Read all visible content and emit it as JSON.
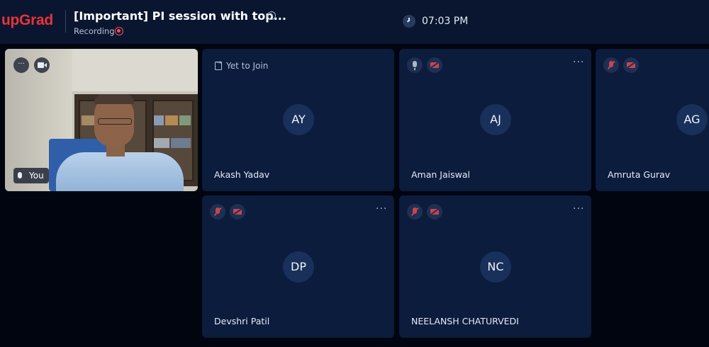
{
  "brand": {
    "logo": "upGrad",
    "accent": "#e8333a"
  },
  "header": {
    "title": "[Important] PI session with top...",
    "info_icon": "i",
    "status": "Recording",
    "time": "07:03 PM"
  },
  "self_tile": {
    "label": "You",
    "more": "···"
  },
  "participants": [
    {
      "initials": "AY",
      "name": "Akash Yadav",
      "status": "Yet to Join"
    },
    {
      "initials": "AJ",
      "name": "Aman Jaiswal",
      "more": "···"
    },
    {
      "initials": "AG",
      "name": "Amruta Gurav"
    },
    {
      "initials": "DP",
      "name": "Devshri Patil",
      "more": "···"
    },
    {
      "initials": "NC",
      "name": "NEELANSH CHATURVEDI",
      "more": "···"
    }
  ],
  "colors": {
    "tile_bg": "#0b1c3d",
    "page_bg": "#01050f",
    "topbar_bg": "#0a162f",
    "muted_red": "#c74552"
  },
  "icons": [
    "info-icon",
    "recording-icon",
    "clock-icon",
    "more-icon",
    "camera-icon",
    "speaker-icon",
    "join-icon",
    "mic-icon",
    "mic-off-icon",
    "camera-off-icon"
  ]
}
